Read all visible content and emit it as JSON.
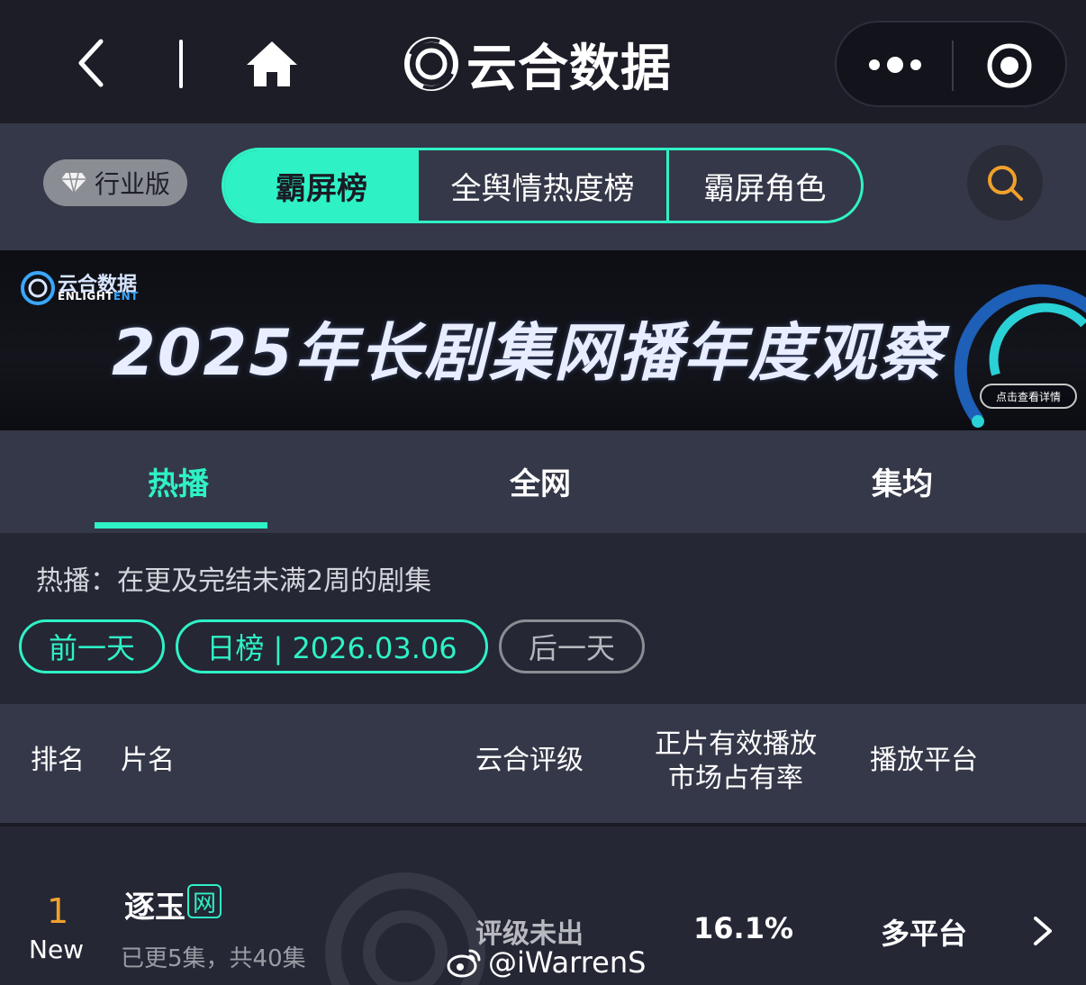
{
  "app": {
    "title": "云合数据"
  },
  "subnav": {
    "industry_label": "行业版",
    "segments": [
      "霸屏榜",
      "全舆情热度榜",
      "霸屏角色"
    ]
  },
  "banner": {
    "brand": "云合数据",
    "brand_en_a": "ENLIGHT",
    "brand_en_b": "ENT",
    "title": "2025年长剧集网播年度观察",
    "cta": "点击查看详情"
  },
  "tabs": [
    "热播",
    "全网",
    "集均"
  ],
  "description": "热播：在更及完结未满2周的剧集",
  "date_nav": {
    "prev": "前一天",
    "current": "日榜 | 2026.03.06",
    "next": "后一天"
  },
  "table": {
    "headers": {
      "rank": "排名",
      "name": "片名",
      "grade": "云合评级",
      "share_line1": "正片有效播放",
      "share_line2": "市场占有率",
      "platform": "播放平台"
    },
    "rows": [
      {
        "rank": "1",
        "tag": "New",
        "title": "逐玉",
        "badge": "网",
        "episodes": "已更5集，共40集",
        "grade": "评级未出",
        "share": "16.1%",
        "platform": "多平台"
      }
    ]
  },
  "watermark_handle": "@iWarrenS",
  "colors": {
    "accent": "#2ef2c6",
    "rank": "#f0a12c",
    "topbar": "#1c1d27",
    "panel": "#353848",
    "background": "#252735"
  }
}
